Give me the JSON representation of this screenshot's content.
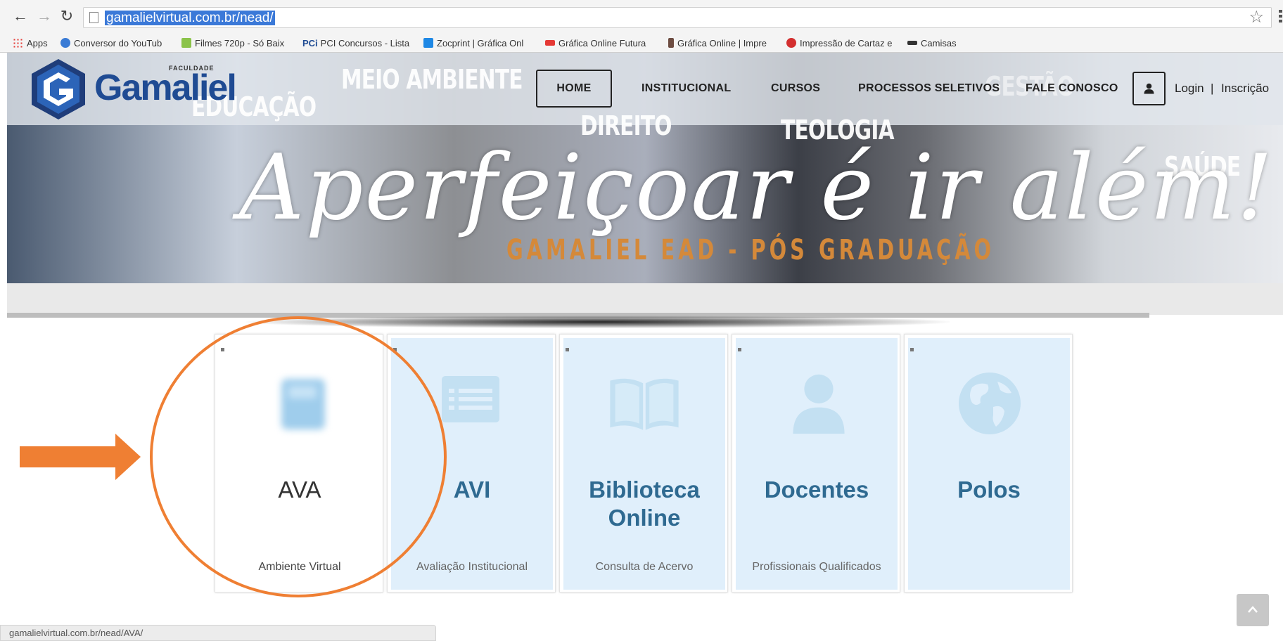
{
  "browser": {
    "url": "gamalielvirtual.com.br/nead/",
    "status_url": "gamalielvirtual.com.br/nead/AVA/",
    "bookmarks": [
      {
        "label": "Apps",
        "icon": "apps-grid-icon"
      },
      {
        "label": "Conversor do YouTub",
        "icon": "converter-icon"
      },
      {
        "label": "Filmes 720p - Só Baix",
        "icon": "download-icon"
      },
      {
        "label": "PCI Concursos - Lista",
        "icon": "pci-logo-icon"
      },
      {
        "label": "Zocprint | Gráfica Onl",
        "icon": "zocprint-icon"
      },
      {
        "label": "Gráfica Online Futura",
        "icon": "futura-icon"
      },
      {
        "label": "Gráfica Online | Impre",
        "icon": "print-icon"
      },
      {
        "label": "Impressão de Cartaz e",
        "icon": "poster-icon"
      },
      {
        "label": "Camisas",
        "icon": "shirt-icon"
      }
    ],
    "pci_prefix": "PCi"
  },
  "site": {
    "logo_small": "FACULDADE",
    "logo_name": "Gamaliel",
    "nav": {
      "home": "HOME",
      "institucional": "INSTITUCIONAL",
      "cursos": "CURSOS",
      "processos": "PROCESSOS SELETIVOS",
      "fale": "FALE CONOSCO"
    },
    "login": "Login",
    "separator": "|",
    "signup": "Inscrição"
  },
  "hero": {
    "words": {
      "educacao": "EDUCAÇÃO",
      "meio_ambiente": "MEIO AMBIENTE",
      "direito": "DIREITO",
      "teologia": "TEOLOGIA",
      "gestao": "GESTÃO",
      "saude": "SAÚDE"
    },
    "slogan": "Aperfeiçoar é ir além!",
    "tagline": "GAMALIEL EAD - PÓS GRADUAÇÃO"
  },
  "cards": [
    {
      "title": "AVA",
      "subtitle": "Ambiente Virtual",
      "icon": "book-icon",
      "active": true
    },
    {
      "title": "AVI",
      "subtitle": "Avaliação Institucional",
      "icon": "list-icon",
      "active": false
    },
    {
      "title": "Biblioteca Online",
      "subtitle": "Consulta de Acervo",
      "icon": "open-book-icon",
      "active": false
    },
    {
      "title": "Docentes",
      "subtitle": "Profissionais Qualificados",
      "icon": "user-icon",
      "active": false
    },
    {
      "title": "Polos",
      "subtitle": "",
      "icon": "globe-icon",
      "active": false
    }
  ],
  "colors": {
    "card_bg": "#e0effb",
    "card_title": "#2f6a91",
    "card_icon": "#c3e0f2",
    "annotation": "#ef7f33",
    "logo_blue": "#1f4b93",
    "url_highlight": "#3b79d8"
  }
}
